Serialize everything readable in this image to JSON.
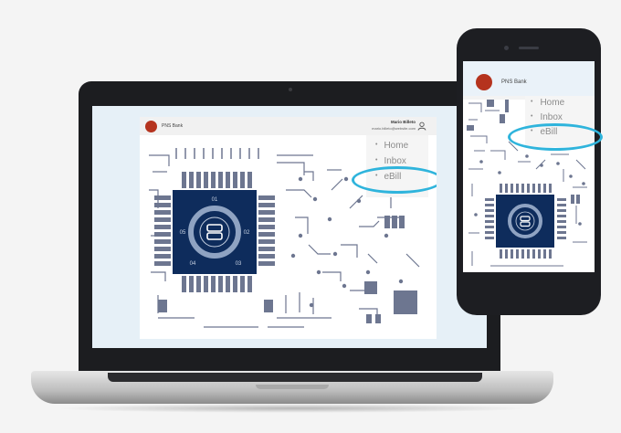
{
  "laptop_site": {
    "bank_name": "PNS Bank",
    "user_name": "Mario Billeto",
    "user_email": "mario.billeto@website.com",
    "menu": [
      {
        "label": "Home"
      },
      {
        "label": "Inbox"
      },
      {
        "label": "eBill"
      }
    ],
    "chip_numbers": [
      "01",
      "02",
      "03",
      "04",
      "05"
    ]
  },
  "phone_site": {
    "bank_name": "PNS Bank",
    "menu": [
      {
        "label": "Home"
      },
      {
        "label": "Inbox"
      },
      {
        "label": "eBill"
      }
    ]
  },
  "colors": {
    "brand_red": "#b5331e",
    "chip_navy": "#0e2c5c",
    "highlight": "#2fb4dc",
    "circuit_gray": "#6d7690",
    "menu_text": "#8c8c8c"
  },
  "icons": [
    "user-icon",
    "logo-icon"
  ]
}
